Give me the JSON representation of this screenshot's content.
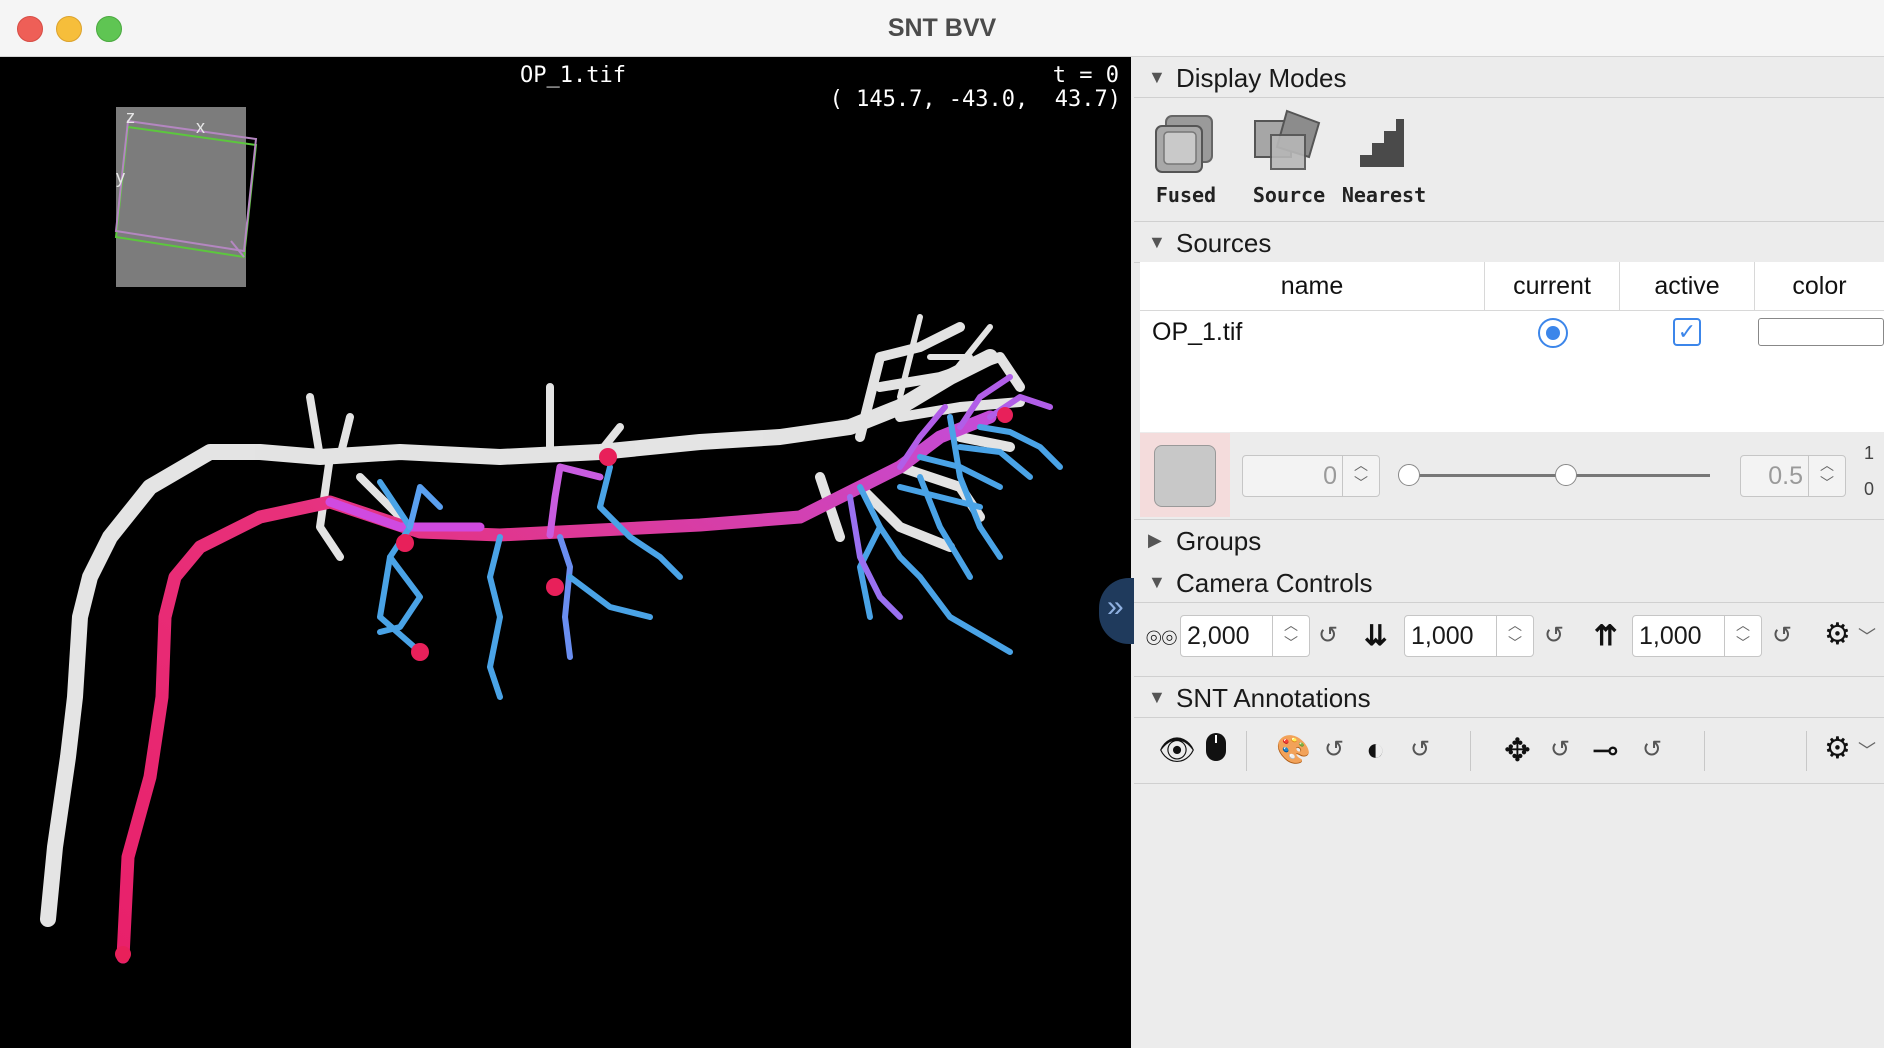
{
  "window": {
    "title": "SNT BVV"
  },
  "viewer": {
    "source_name": "OP_1.tif",
    "time_label": "t = 0",
    "coordinates": "( 145.7, -43.0,  43.7)",
    "axes": {
      "z": "z",
      "x": "x",
      "y": "y"
    }
  },
  "sidebar": {
    "display_modes": {
      "title": "Display Modes",
      "modes": [
        {
          "label": "Fused",
          "icon": "fused-icon"
        },
        {
          "label": "Source",
          "icon": "source-icon"
        },
        {
          "label": "Nearest",
          "icon": "nearest-icon"
        }
      ]
    },
    "sources": {
      "title": "Sources",
      "columns": [
        "name",
        "current",
        "active",
        "color"
      ],
      "rows": [
        {
          "name": "OP_1.tif",
          "current": true,
          "active": true,
          "color": "#ffffff"
        }
      ],
      "min_value": "0",
      "max_value": "0.5",
      "range_labels": {
        "top": "1",
        "bottom": "0"
      },
      "swatch_color": "#c8c8c8"
    },
    "groups": {
      "title": "Groups"
    },
    "camera_controls": {
      "title": "Camera Controls",
      "distance": "2,000",
      "near_clip": "1,000",
      "far_clip": "1,000"
    },
    "snt_annotations": {
      "title": "SNT Annotations"
    }
  },
  "colors": {
    "accent": "#3c86ea",
    "trace_pink": "#e8307a",
    "trace_blue": "#4aa3e6",
    "trace_purple": "#b15ee8"
  }
}
